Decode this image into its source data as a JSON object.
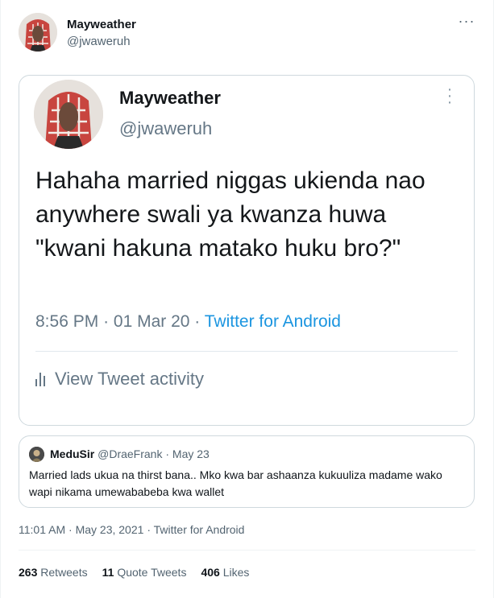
{
  "tweet": {
    "display_name": "Mayweather",
    "handle": "@jwaweruh",
    "more_icon": "more-horizontal-icon"
  },
  "screenshot": {
    "display_name": "Mayweather",
    "handle": "@jwaweruh",
    "body": "Hahaha married niggas ukienda nao anywhere swali ya kwanza huwa \"kwani hakuna matako huku bro?\"",
    "time": "8:56 PM",
    "date": "01 Mar 20",
    "source": "Twitter for Android",
    "activity_label": "View Tweet activity"
  },
  "quote": {
    "name": "MeduSir",
    "handle": "@DraeFrank",
    "date": "May 23",
    "text": "Married lads ukua na thirst bana.. Mko kwa bar ashaanza kukuuliza madame wako wapi nikama umewababeba kwa wallet"
  },
  "meta": {
    "time": "11:01 AM",
    "date": "May 23, 2021",
    "source": "Twitter for Android"
  },
  "stats": {
    "retweets_count": "263",
    "retweets_label": "Retweets",
    "quotes_count": "11",
    "quotes_label": "Quote Tweets",
    "likes_count": "406",
    "likes_label": "Likes"
  },
  "colors": {
    "link": "#1b95e0",
    "secondary": "#536471",
    "border": "#cfd9de"
  }
}
